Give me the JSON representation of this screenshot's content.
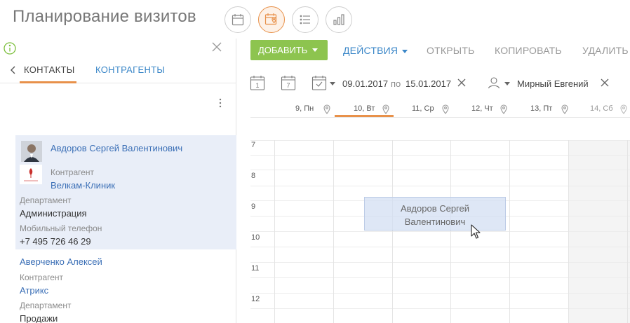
{
  "page": {
    "title": "Планирование визитов"
  },
  "view_buttons": [
    {
      "icon": "calendar-icon",
      "active": false
    },
    {
      "icon": "calendar-pin-icon",
      "active": true
    },
    {
      "icon": "list-icon",
      "active": false
    },
    {
      "icon": "analytics-icon",
      "active": false
    }
  ],
  "left_panel": {
    "tabs": [
      {
        "label": "КОНТАКТЫ",
        "active": true
      },
      {
        "label": "КОНТРАГЕНТЫ",
        "active": false
      }
    ],
    "contacts": [
      {
        "name": "Авдоров Сергей Валентинович",
        "account_label": "Контрагент",
        "account": "Велкам-Клиник",
        "department_label": "Департамент",
        "department": "Администрация",
        "phone_label": "Мобильный телефон",
        "phone": "+7 495 726 46 29"
      },
      {
        "name": "Аверченко Алексей",
        "account_label": "Контрагент",
        "account": "Атрикс",
        "department_label": "Департамент",
        "department": "Продажи"
      }
    ]
  },
  "toolbar": {
    "add_label": "ДОБАВИТЬ",
    "actions_label": "ДЕЙСТВИЯ",
    "open_label": "ОТКРЫТЬ",
    "copy_label": "КОПИРОВАТЬ",
    "delete_label": "УДАЛИТЬ"
  },
  "filter": {
    "day_icon_text": "1",
    "week_icon_text": "7",
    "date_from": "09.01.2017",
    "date_separator": "по",
    "date_to": "15.01.2017",
    "owner": "Мирный Евгений"
  },
  "calendar": {
    "days": [
      {
        "label": "9, Пн",
        "weekend": false
      },
      {
        "label": "10, Вт",
        "weekend": false,
        "selected": true
      },
      {
        "label": "11, Ср",
        "weekend": false
      },
      {
        "label": "12, Чт",
        "weekend": false
      },
      {
        "label": "13, Пт",
        "weekend": false
      },
      {
        "label": "14, Сб",
        "weekend": true
      }
    ],
    "hours": [
      "7",
      "8",
      "9",
      "10",
      "11",
      "12"
    ],
    "event": {
      "line1": "Авдоров Сергей",
      "line2": "Валентинович"
    }
  },
  "colors": {
    "accent": "#e8914a",
    "add_button": "#8dc44f",
    "link": "#3b87c8",
    "selected_card": "#e9eef8",
    "event_bg": "#d3dff3"
  }
}
